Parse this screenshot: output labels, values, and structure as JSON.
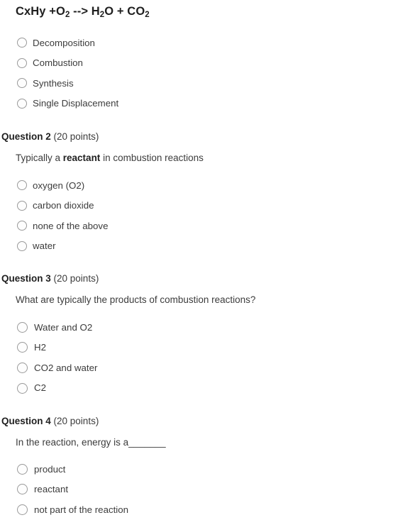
{
  "document": {
    "type": "quiz",
    "background_color": "#ffffff",
    "text_color": "#3c3c3c",
    "heading_color": "#1f1f1f",
    "radio_border_color": "#9a9a9a"
  },
  "equation_heading": {
    "full_text": "CxHy +O2 --> H2O + CO2",
    "part1": "CxHy +O",
    "sub1": "2",
    "part2": " --> H",
    "sub2": "2",
    "part3": "O + CO",
    "sub3": "2"
  },
  "question1": {
    "options": [
      {
        "label": "Decomposition",
        "selected": false
      },
      {
        "label": "Combustion",
        "selected": false
      },
      {
        "label": "Synthesis",
        "selected": false
      },
      {
        "label": "Single Displacement",
        "selected": false
      }
    ]
  },
  "question2": {
    "label": "Question 2",
    "points": "(20 points)",
    "prompt_before": "Typically a ",
    "prompt_bold": "reactant",
    "prompt_after": " in combustion reactions",
    "options": [
      {
        "label": "oxygen (O2)",
        "selected": false
      },
      {
        "label": "carbon dioxide",
        "selected": false
      },
      {
        "label": "none of the above",
        "selected": false
      },
      {
        "label": "water",
        "selected": false
      }
    ]
  },
  "question3": {
    "label": "Question 3",
    "points": "(20 points)",
    "prompt": "What are typically the products of combustion reactions?",
    "options": [
      {
        "label": "Water and O2",
        "selected": false
      },
      {
        "label": "H2",
        "selected": false
      },
      {
        "label": "CO2 and water",
        "selected": false
      },
      {
        "label": "C2",
        "selected": false
      }
    ]
  },
  "question4": {
    "label": "Question 4",
    "points": "(20 points)",
    "prompt": "In the reaction, energy is a_______",
    "options": [
      {
        "label": "product",
        "selected": false
      },
      {
        "label": "reactant",
        "selected": false
      },
      {
        "label": "not part of the reaction",
        "selected": false
      }
    ]
  }
}
